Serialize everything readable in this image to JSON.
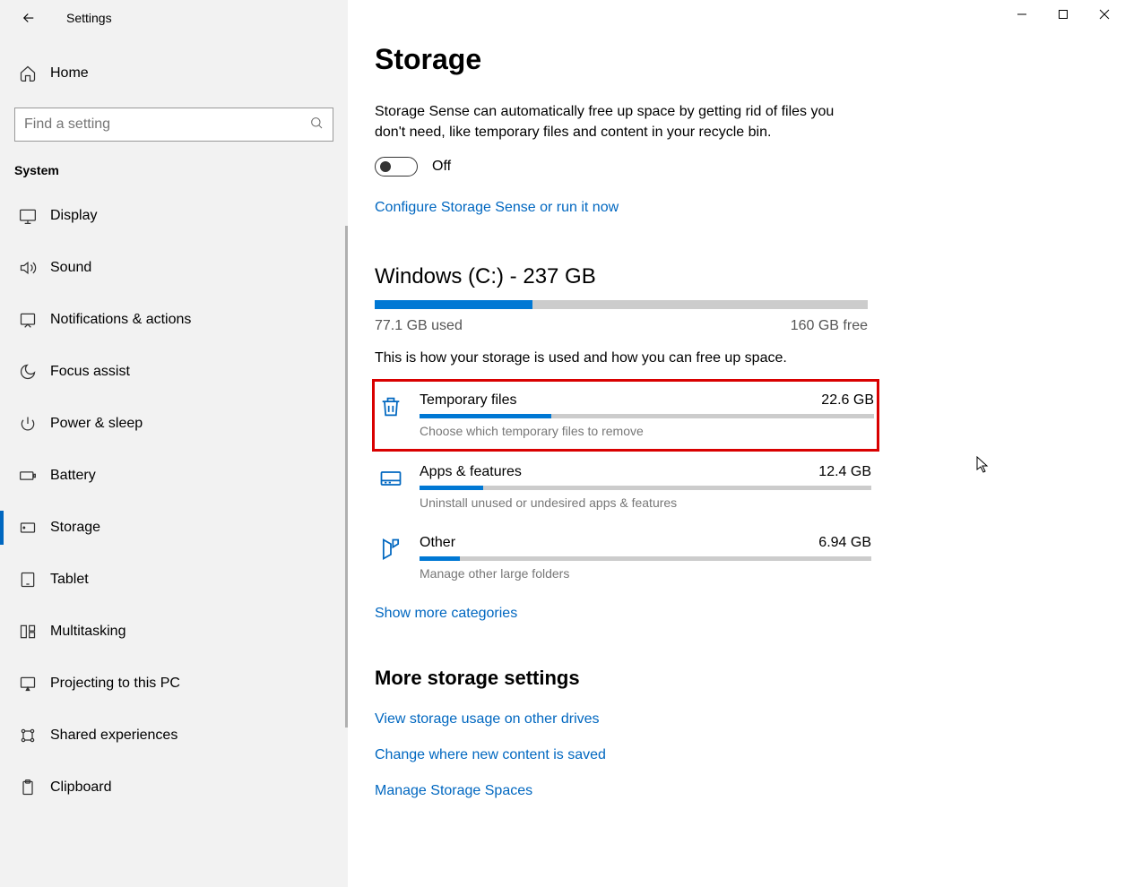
{
  "app": {
    "title": "Settings"
  },
  "sidebar": {
    "home": "Home",
    "search_placeholder": "Find a setting",
    "section": "System",
    "items": [
      {
        "icon": "display",
        "label": "Display"
      },
      {
        "icon": "sound",
        "label": "Sound"
      },
      {
        "icon": "notifications",
        "label": "Notifications & actions"
      },
      {
        "icon": "focus",
        "label": "Focus assist"
      },
      {
        "icon": "power",
        "label": "Power & sleep"
      },
      {
        "icon": "battery",
        "label": "Battery"
      },
      {
        "icon": "storage",
        "label": "Storage"
      },
      {
        "icon": "tablet",
        "label": "Tablet"
      },
      {
        "icon": "multitask",
        "label": "Multitasking"
      },
      {
        "icon": "projecting",
        "label": "Projecting to this PC"
      },
      {
        "icon": "shared",
        "label": "Shared experiences"
      },
      {
        "icon": "clipboard",
        "label": "Clipboard"
      }
    ]
  },
  "page": {
    "title": "Storage",
    "description": "Storage Sense can automatically free up space by getting rid of files you don't need, like temporary files and content in your recycle bin.",
    "toggle_label": "Off",
    "configure_link": "Configure Storage Sense or run it now",
    "drive": {
      "title": "Windows (C:) - 237 GB",
      "used": "77.1 GB used",
      "free": "160 GB free",
      "fill_pct": 32
    },
    "usage_desc": "This is how your storage is used and how you can free up space.",
    "categories": [
      {
        "name": "Temporary files",
        "size": "22.6 GB",
        "desc": "Choose which temporary files to remove",
        "fill_pct": 29,
        "highlighted": true,
        "icon": "trash"
      },
      {
        "name": "Apps & features",
        "size": "12.4 GB",
        "desc": "Uninstall unused or undesired apps & features",
        "fill_pct": 14,
        "highlighted": false,
        "icon": "apps"
      },
      {
        "name": "Other",
        "size": "6.94 GB",
        "desc": "Manage other large folders",
        "fill_pct": 9,
        "highlighted": false,
        "icon": "other"
      }
    ],
    "show_more": "Show more categories",
    "more_settings_title": "More storage settings",
    "more_links": [
      "View storage usage on other drives",
      "Change where new content is saved",
      "Manage Storage Spaces"
    ]
  }
}
